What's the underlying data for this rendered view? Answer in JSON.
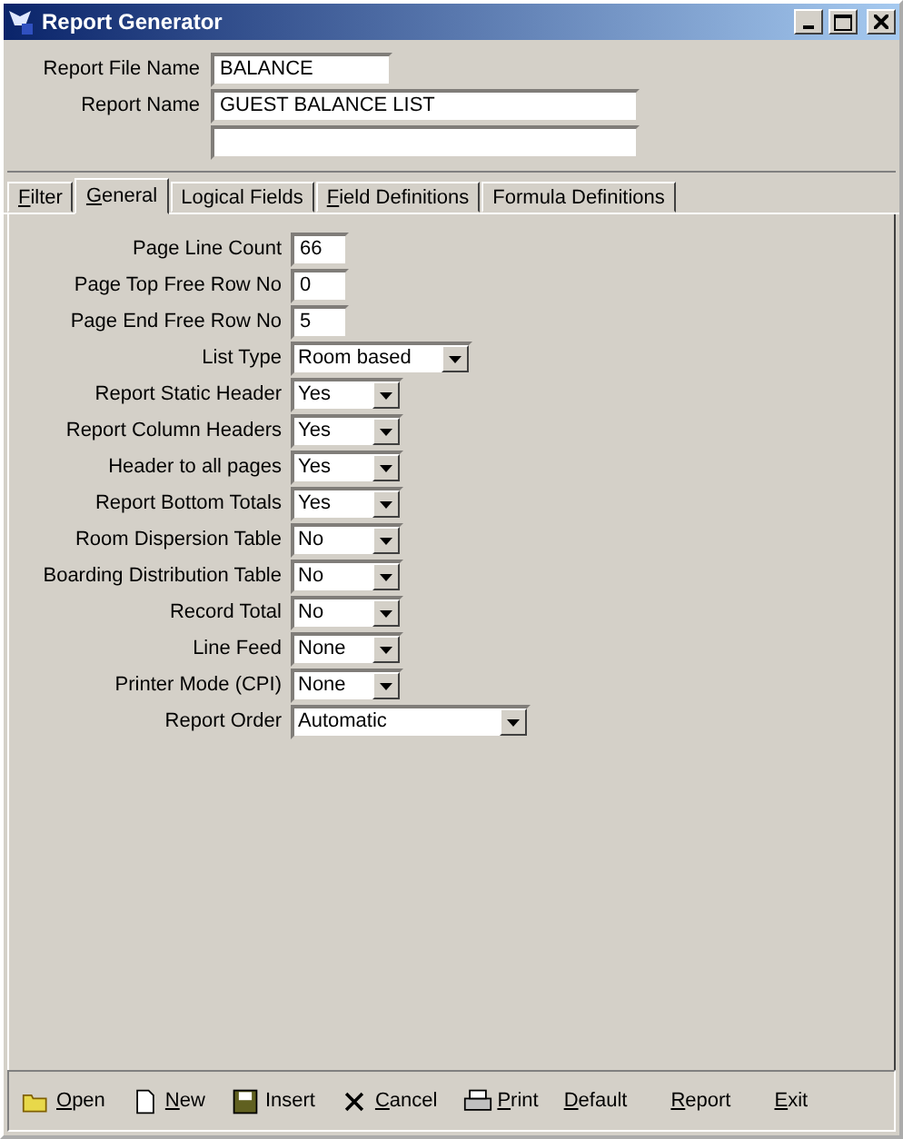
{
  "window": {
    "title": "Report Generator"
  },
  "header": {
    "fields": [
      {
        "label": "Report File Name",
        "value": "BALANCE",
        "kind": "short"
      },
      {
        "label": "Report Name",
        "value": "GUEST BALANCE LIST",
        "kind": "long"
      },
      {
        "kind": "long"
      }
    ]
  },
  "tabs": [
    {
      "label": "Filter",
      "selected": false,
      "mnemonic": true
    },
    {
      "label": "General",
      "selected": true,
      "mnemonic": true
    },
    {
      "label": "Logical Fields",
      "selected": false,
      "mnemonic": false
    },
    {
      "label": "Field Definitions",
      "selected": false,
      "mnemonic": true
    },
    {
      "label": "Formula Definitions",
      "selected": false,
      "mnemonic": false
    }
  ],
  "settings": [
    {
      "label": "Page Line Count",
      "value": "66",
      "kind": "text"
    },
    {
      "label": "Page Top Free Row No",
      "value": "0",
      "kind": "text"
    },
    {
      "label": "Page End Free Row No",
      "value": "5",
      "kind": "text"
    },
    {
      "label": "List Type",
      "value": "Room based",
      "kind": "medium"
    },
    {
      "label": "Report Static Header",
      "value": "Yes",
      "kind": "small"
    },
    {
      "label": "Report Column Headers",
      "value": "Yes",
      "kind": "small"
    },
    {
      "label": "Header to all pages",
      "value": "Yes",
      "kind": "small"
    },
    {
      "label": "Report Bottom Totals",
      "value": "Yes",
      "kind": "small"
    },
    {
      "label": "Room Dispersion Table",
      "value": "No",
      "kind": "small"
    },
    {
      "label": "Boarding Distribution Table",
      "value": "No",
      "kind": "small"
    },
    {
      "label": "Record Total",
      "value": "No",
      "kind": "small"
    },
    {
      "label": "Line Feed",
      "value": "None",
      "kind": "small"
    },
    {
      "label": "Printer Mode (CPI)",
      "value": "None",
      "kind": "small"
    },
    {
      "label": "Report Order",
      "value": "Automatic",
      "kind": "wide"
    }
  ],
  "toolbar": [
    {
      "label": "Open",
      "mnemonic": true
    },
    {
      "label": "New",
      "mnemonic": true
    },
    {
      "label": "Insert",
      "mnemonic": false
    },
    {
      "label": "Cancel",
      "mnemonic": true
    },
    {
      "label": "Print",
      "mnemonic": true
    },
    {
      "label": "Default",
      "mnemonic": true
    },
    {
      "label": "Report",
      "mnemonic": true
    },
    {
      "label": "Exit",
      "mnemonic": true
    }
  ]
}
